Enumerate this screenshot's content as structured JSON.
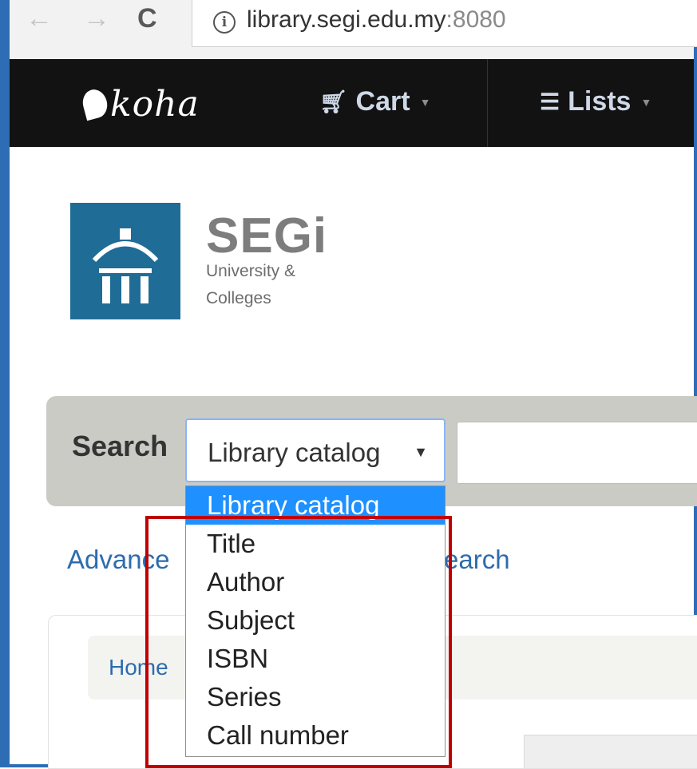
{
  "browser": {
    "url_host": "library.segi.edu.my",
    "url_port": ":8080"
  },
  "navbar": {
    "logo_text": "koha",
    "cart_label": "Cart",
    "lists_label": "Lists"
  },
  "header": {
    "brand_name": "SEGi",
    "brand_line1": "University &",
    "brand_line2": "Colleges"
  },
  "search": {
    "label": "Search",
    "selected": "Library catalog",
    "options": [
      "Library catalog",
      "Title",
      "Author",
      "Subject",
      "ISBN",
      "Series",
      "Call number"
    ]
  },
  "links": {
    "advanced_visible": "Advance",
    "advanced_tail": "earch"
  },
  "breadcrumb": {
    "home": "Home"
  },
  "colors": {
    "navbar_bg": "#121212",
    "selected_option": "#1e90ff",
    "annotation": "#c00000",
    "logo_blue": "#1f6d97"
  }
}
